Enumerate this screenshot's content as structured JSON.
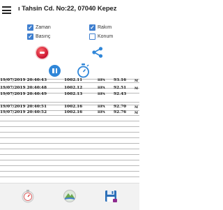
{
  "header": {
    "menu_icon": "hamburger-menu-icon",
    "address": "ı Tahsin Cd. No:22, 07040 Kepez"
  },
  "options": {
    "zaman": {
      "label": "Zaman",
      "checked": true
    },
    "rakim": {
      "label": "Rakım",
      "checked": true
    },
    "basinc": {
      "label": "Basınç",
      "checked": true
    },
    "konum": {
      "label": "Konum",
      "checked": false
    }
  },
  "actions": {
    "record_icon": "record-stop-icon",
    "share_icon": "share-icon",
    "pause_icon": "pause-icon",
    "timer_icon": "stopwatch-icon"
  },
  "log": {
    "rows": [
      {
        "datetime": "19/07/2019 20:40:43",
        "pressure": "1002.11",
        "unit": "HPA",
        "altitude": "93.16",
        "alt_unit": "M"
      },
      {
        "datetime": "19/07/2019 20:40:48",
        "pressure": "1002.12",
        "unit": "HPA",
        "altitude": "92.51",
        "alt_unit": "M"
      },
      {
        "datetime": "19/07/2019 20:40:49",
        "pressure": "1002.13",
        "unit": "HPA",
        "altitude": "92.43",
        "alt_unit": ""
      },
      {
        "datetime": "19/07/2019 20:40:51",
        "pressure": "1002.16",
        "unit": "HPA",
        "altitude": "92.70",
        "alt_unit": "M"
      },
      {
        "datetime": "19/07/2019 20:40:52",
        "pressure": "1002.16",
        "unit": "HPA",
        "altitude": "92.76",
        "alt_unit": "M"
      }
    ]
  },
  "bottom_nav": {
    "items": [
      {
        "icon": "barometer-gauge-icon"
      },
      {
        "icon": "altitude-map-icon"
      },
      {
        "icon": "save-icon"
      }
    ]
  },
  "colors": {
    "accent": "#3f7fcf",
    "record": "#c8102e",
    "pause": "#2f86d8"
  }
}
